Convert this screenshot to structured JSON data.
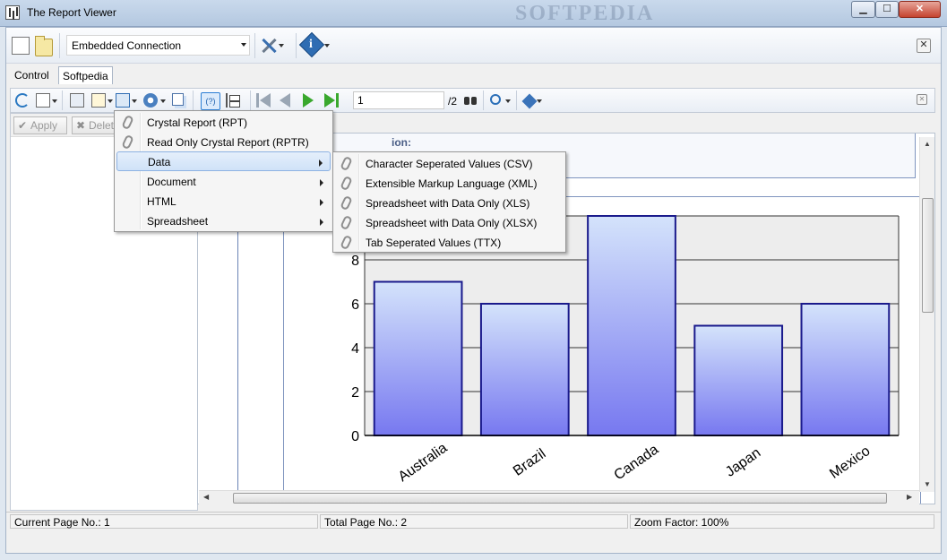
{
  "window": {
    "title": "The Report Viewer",
    "watermark": "SOFTPEDIA",
    "minimize_glyph": "▁",
    "maximize_glyph": "☐",
    "close_glyph": "✕"
  },
  "toolbar": {
    "connection_value": "Embedded Connection",
    "info_glyph": "i",
    "close_glyph": "✕"
  },
  "tabs": [
    {
      "label": "Control",
      "active": false
    },
    {
      "label": "Softpedia",
      "active": true
    }
  ],
  "report_toolbar": {
    "page_value": "1",
    "page_total": "/2",
    "help_glyph": "(?)",
    "close_glyph": "✕"
  },
  "left_panel": {
    "apply_label": "Apply",
    "delete_label": "Delet",
    "apply_glyph": "✔",
    "delete_glyph": "✖"
  },
  "report": {
    "param_label": "ion:"
  },
  "export_menu": {
    "items": [
      {
        "label": "Crystal Report (RPT)",
        "submenu": false
      },
      {
        "label": "Read Only Crystal Report (RPTR)",
        "submenu": false
      },
      {
        "label": "Data",
        "submenu": true,
        "highlighted": true
      },
      {
        "label": "Document",
        "submenu": true
      },
      {
        "label": "HTML",
        "submenu": true
      },
      {
        "label": "Spreadsheet",
        "submenu": true
      }
    ]
  },
  "data_submenu": {
    "items": [
      {
        "label": "Character Seperated Values (CSV)"
      },
      {
        "label": "Extensible Markup Language (XML)"
      },
      {
        "label": "Spreadsheet with Data Only (XLS)"
      },
      {
        "label": "Spreadsheet with Data Only (XLSX)"
      },
      {
        "label": "Tab Seperated Values (TTX)"
      }
    ]
  },
  "status": {
    "current_page": "Current Page No.: 1",
    "total_page": "Total Page No.: 2",
    "zoom": "Zoom Factor: 100%"
  },
  "chart_data": {
    "type": "bar",
    "categories": [
      "Australia",
      "Brazil",
      "Canada",
      "Japan",
      "Mexico"
    ],
    "values": [
      7,
      6,
      10,
      5,
      6
    ],
    "yticks": [
      0,
      2,
      4,
      6,
      8
    ],
    "ylim": [
      0,
      10
    ],
    "grid": true,
    "bar_color_top": "#d4e3fb",
    "bar_color_bottom": "#7778f0",
    "bar_stroke": "#1a1a8c"
  }
}
